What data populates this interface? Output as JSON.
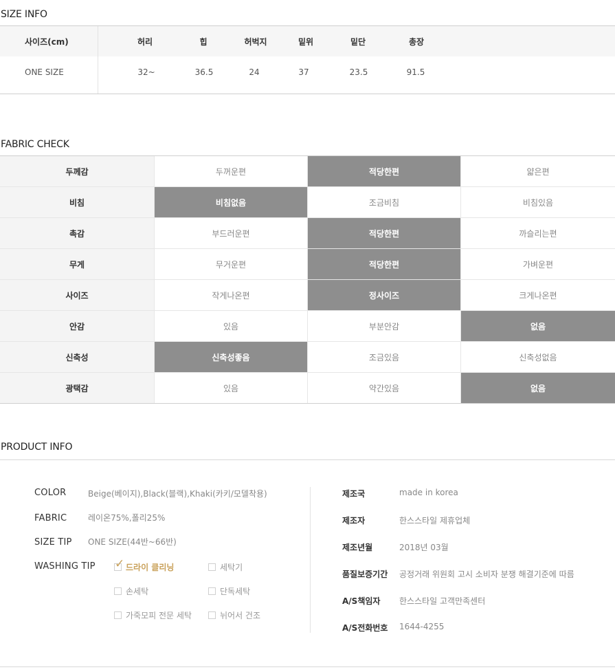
{
  "size_info": {
    "title": "SIZE INFO",
    "header_label": "사이즈(cm)",
    "columns": [
      "허리",
      "힙",
      "허벅지",
      "밑위",
      "밑단",
      "총장"
    ],
    "row_label": "ONE SIZE",
    "values": [
      "32~",
      "36.5",
      "24",
      "37",
      "23.5",
      "91.5"
    ]
  },
  "fabric_check": {
    "title": "FABRIC CHECK",
    "rows": [
      {
        "label": "두께감",
        "options": [
          "두꺼운편",
          "적당한편",
          "얇은편"
        ],
        "selected": 1
      },
      {
        "label": "비침",
        "options": [
          "비침없음",
          "조금비침",
          "비침있음"
        ],
        "selected": 0
      },
      {
        "label": "촉감",
        "options": [
          "부드러운편",
          "적당한편",
          "까슬리는편"
        ],
        "selected": 1
      },
      {
        "label": "무게",
        "options": [
          "무거운편",
          "적당한편",
          "가벼운편"
        ],
        "selected": 1
      },
      {
        "label": "사이즈",
        "options": [
          "작게나온편",
          "정사이즈",
          "크게나온편"
        ],
        "selected": 1
      },
      {
        "label": "안감",
        "options": [
          "있음",
          "부분안감",
          "없음"
        ],
        "selected": 2
      },
      {
        "label": "신축성",
        "options": [
          "신축성좋음",
          "조금있음",
          "신축성없음"
        ],
        "selected": 0
      },
      {
        "label": "광택감",
        "options": [
          "있음",
          "약간있음",
          "없음"
        ],
        "selected": 2
      }
    ],
    "selected_color": "#8e8e8e"
  },
  "product_info": {
    "title": "PRODUCT INFO",
    "color_key": "COLOR",
    "color_val": "Beige(베이지),Black(블랙),Khaki(카키/모델착용)",
    "fabric_key": "FABRIC",
    "fabric_val": "레이온75%,폴리25%",
    "size_tip_key": "SIZE TIP",
    "size_tip_val": "ONE SIZE(44반~66반)",
    "washing_key": "WASHING TIP",
    "washing": {
      "dry_cleaning": "드라이 클리닝",
      "machine": "세탁기",
      "hand": "손세탁",
      "single": "단독세탁",
      "leather": "가죽모피 전문 세탁",
      "flat_dry": "뉘어서 건조",
      "checked": "dry_cleaning",
      "check_color": "#c9a15a"
    },
    "right": {
      "origin_key": "제조국",
      "origin_val": "made in korea",
      "maker_key": "제조자",
      "maker_val": "한스스타일 제휴업체",
      "date_key": "제조년월",
      "date_val": "2018년 03월",
      "warranty_key": "품질보증기간",
      "warranty_val": "공정거래 위원회 고시 소비자 분쟁 해결기준에 따름",
      "as_key": "A/S책임자",
      "as_val": "한스스타일 고객만족센터",
      "phone_key": "A/S전화번호",
      "phone_val": "1644-4255"
    }
  }
}
